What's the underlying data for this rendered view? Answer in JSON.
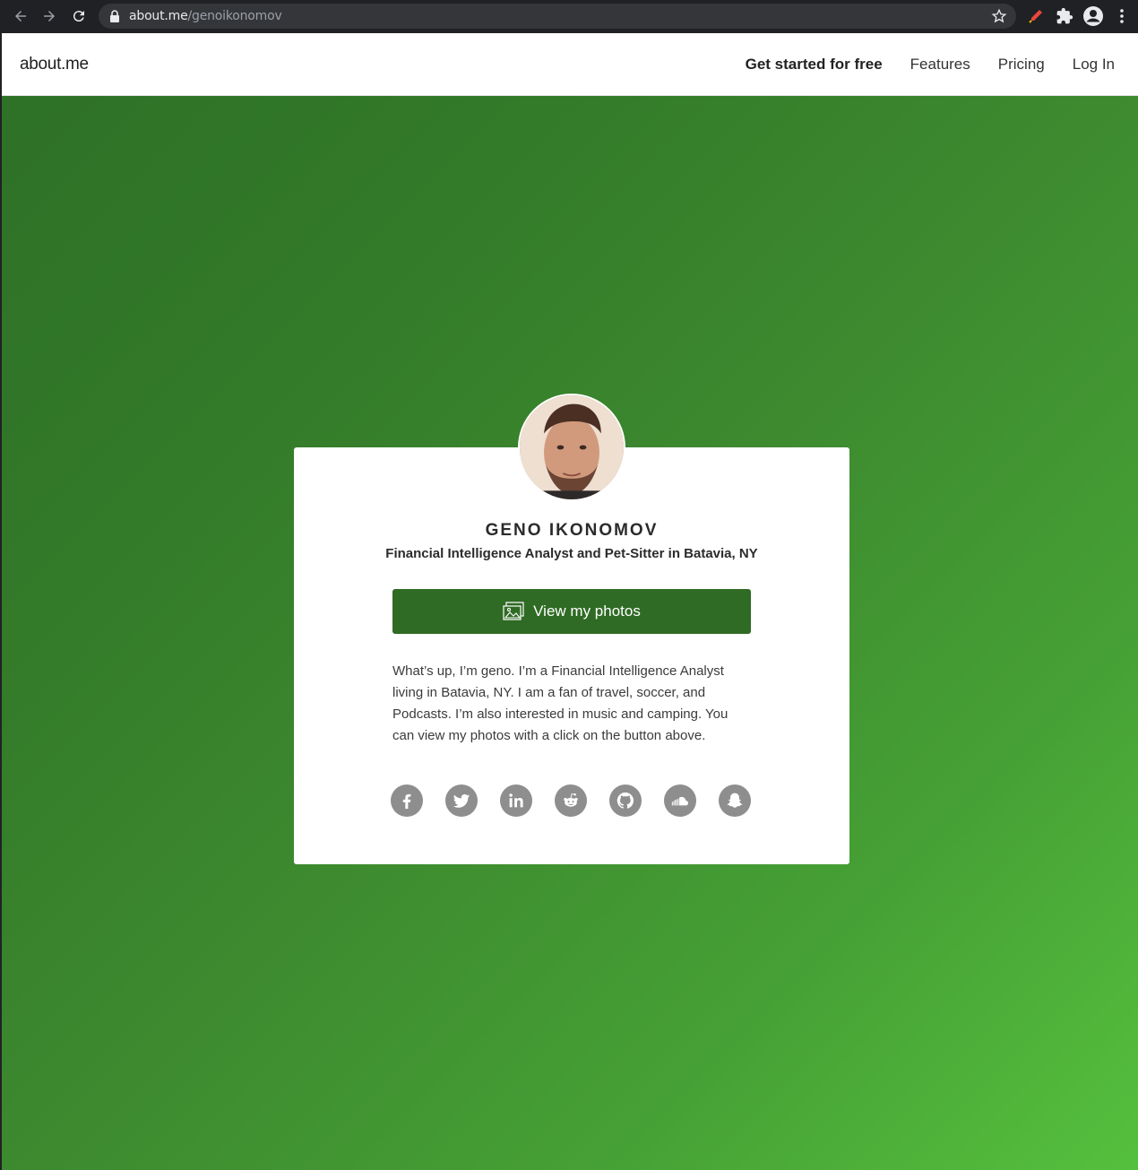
{
  "browser": {
    "url_host": "about.me",
    "url_path": "/genoikonomov"
  },
  "header": {
    "logo": "about.me",
    "nav": {
      "get_started": "Get started for free",
      "features": "Features",
      "pricing": "Pricing",
      "login": "Log In"
    }
  },
  "profile": {
    "name": "GENO IKONOMOV",
    "headline": "Financial Intelligence Analyst and Pet-Sitter in Batavia, NY",
    "button_label": "View my photos",
    "bio": "What’s up, I’m geno. I’m a Financial Intelligence Analyst living in Batavia, NY. I am a fan of travel, soccer, and Podcasts. I’m also interested in music and camping. You can view my photos with a click on the button above.",
    "social_icons": [
      "facebook-icon",
      "twitter-icon",
      "linkedin-icon",
      "reddit-icon",
      "github-icon",
      "soundcloud-icon",
      "snapchat-icon"
    ]
  },
  "colors": {
    "button": "#2f6b24",
    "gradient_start": "#2e7127",
    "gradient_end": "#55c03d",
    "social_icon": "#8e8e8e"
  }
}
